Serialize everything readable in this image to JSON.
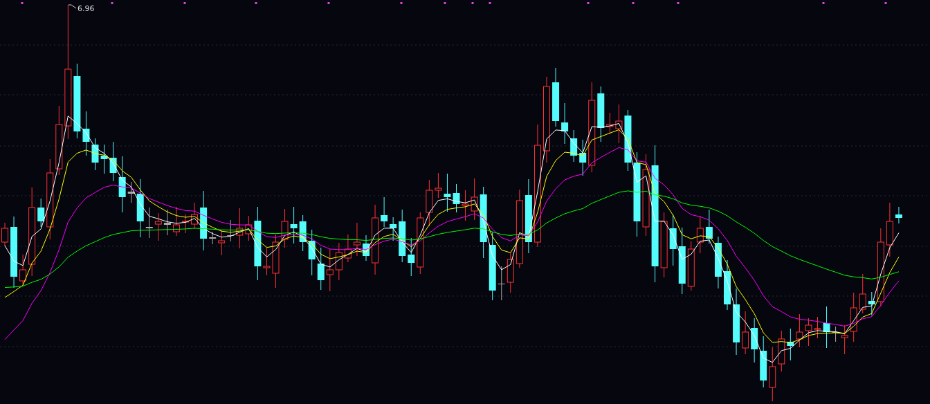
{
  "chart": {
    "high_label": "6.96"
  }
}
